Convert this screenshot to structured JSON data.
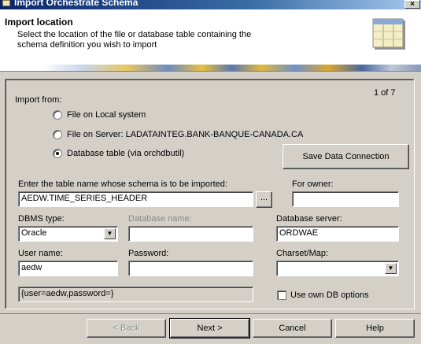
{
  "window": {
    "title": "Import Orchestrate Schema",
    "close_glyph": "×"
  },
  "header": {
    "title": "Import location",
    "description": "Select the location of the file or database table containing the schema definition you wish to import"
  },
  "page_counter": "1 of 7",
  "import_from": {
    "label": "Import from:",
    "options": [
      {
        "label": "File on Local system",
        "selected": false
      },
      {
        "label": "File on Server: LADATAINTEG.BANK-BANQUE-CANADA.CA",
        "selected": false
      },
      {
        "label": "Database table (via orchdbutil)",
        "selected": true
      }
    ]
  },
  "save_connection_label": "Save Data Connection",
  "table": {
    "label": "Enter the table name whose schema is to be imported:",
    "value": "AEDW.TIME_SERIES_HEADER",
    "browse_label": "..."
  },
  "owner": {
    "label": "For owner:",
    "value": ""
  },
  "dbms": {
    "label": "DBMS type:",
    "value": "Oracle"
  },
  "database_name": {
    "label": "Database name:",
    "value": ""
  },
  "database_server": {
    "label": "Database server:",
    "value": "ORDWAE"
  },
  "user": {
    "label": "User name:",
    "value": "aedw"
  },
  "password": {
    "label": "Password:",
    "value": ""
  },
  "charset": {
    "label": "Charset/Map:",
    "value": ""
  },
  "connection_string": "{user=aedw,password=}",
  "own_db_options": {
    "label": "Use own DB options",
    "checked": false
  },
  "footer": {
    "back": "< Back",
    "next": "Next >",
    "cancel": "Cancel",
    "help": "Help"
  }
}
